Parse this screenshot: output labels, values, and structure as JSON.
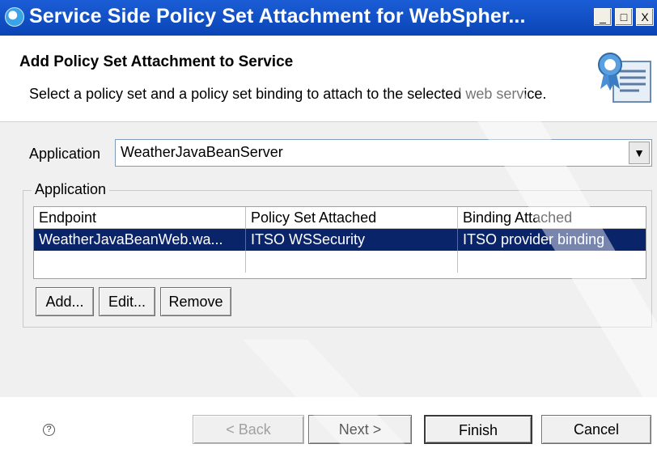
{
  "window": {
    "title": "Service Side Policy Set Attachment for WebSpher...",
    "controls": {
      "minimize": "_",
      "maximize": "□",
      "close": "X"
    }
  },
  "header": {
    "title": "Add Policy Set Attachment to Service",
    "description": "Select a policy set and a policy set binding to attach to the selected web service.",
    "image_icon": "wizard-banner-certificate-icon"
  },
  "form": {
    "application_label": "Application",
    "application_value": "WeatherJavaBeanServer",
    "dropdown_icon": "chevron-down-icon"
  },
  "group": {
    "legend": "Application",
    "table": {
      "columns": [
        "Endpoint",
        "Policy Set Attached",
        "Binding Attached"
      ],
      "rows": [
        [
          "WeatherJavaBeanWeb.wa...",
          "ITSO WSSecurity",
          "ITSO provider binding"
        ],
        [
          "",
          "",
          ""
        ]
      ]
    },
    "buttons": {
      "add": "Add...",
      "edit": "Edit...",
      "remove": "Remove"
    }
  },
  "footer": {
    "help": "?",
    "back": "< Back",
    "next": "Next >",
    "finish": "Finish",
    "cancel": "Cancel"
  },
  "colors": {
    "titlebar": "#0a44b6",
    "selection": "#0a246a",
    "dialog_bg": "#f0f0f0"
  }
}
